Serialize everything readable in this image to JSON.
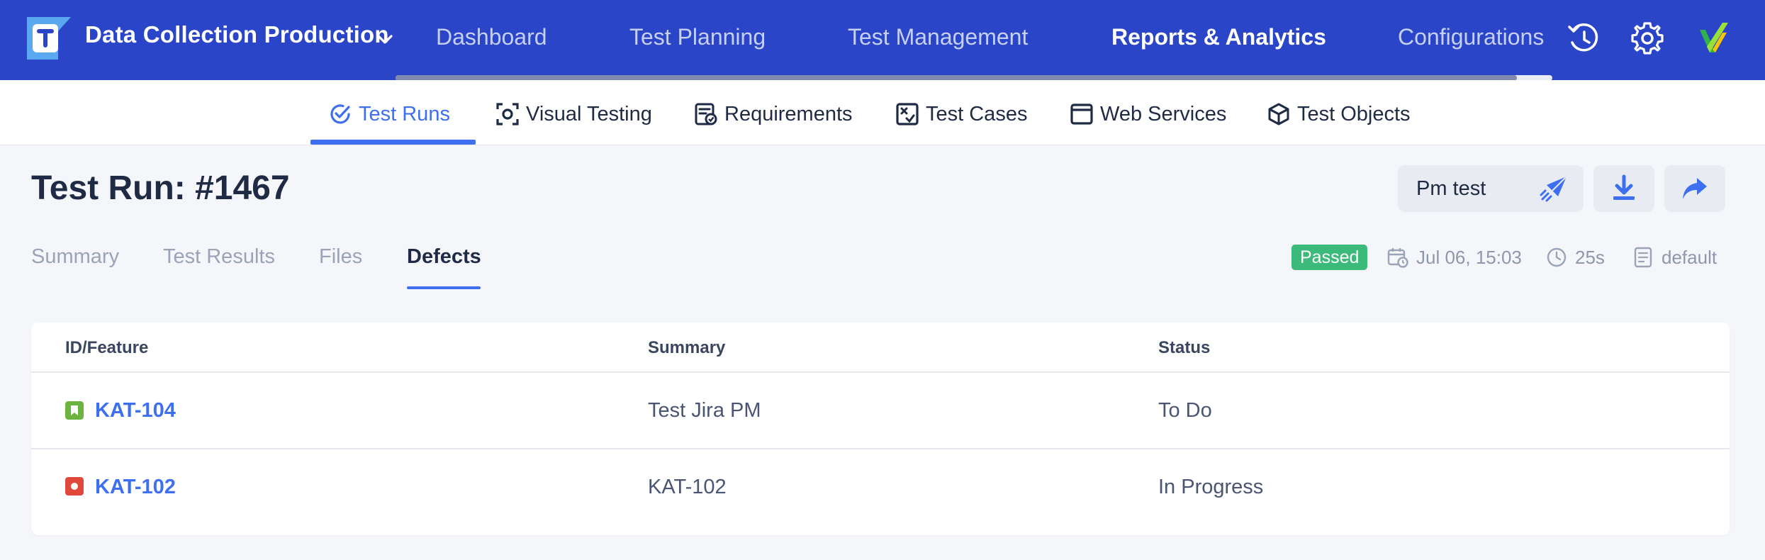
{
  "topbar": {
    "project_name": "Data Collection Production",
    "nav": [
      {
        "label": "Dashboard",
        "active": false
      },
      {
        "label": "Test Planning",
        "active": false
      },
      {
        "label": "Test Management",
        "active": false
      },
      {
        "label": "Reports & Analytics",
        "active": true
      },
      {
        "label": "Configurations",
        "active": false
      }
    ],
    "icons": [
      "history-icon",
      "gear-icon",
      "app-logo-icon"
    ]
  },
  "subnav": {
    "tabs": [
      {
        "label": "Test Runs",
        "icon": "check-circle-icon",
        "active": true
      },
      {
        "label": "Visual Testing",
        "icon": "camera-frame-icon",
        "active": false
      },
      {
        "label": "Requirements",
        "icon": "requirements-icon",
        "active": false
      },
      {
        "label": "Test Cases",
        "icon": "test-cases-icon",
        "active": false
      },
      {
        "label": "Web Services",
        "icon": "browser-window-icon",
        "active": false
      },
      {
        "label": "Test Objects",
        "icon": "cube-icon",
        "active": false
      }
    ]
  },
  "page": {
    "title": "Test Run: #1467",
    "run_button_label": "Pm test",
    "tabs": [
      {
        "label": "Summary",
        "active": false
      },
      {
        "label": "Test Results",
        "active": false
      },
      {
        "label": "Files",
        "active": false
      },
      {
        "label": "Defects",
        "active": true
      }
    ],
    "meta": {
      "status": "Passed",
      "date": "Jul 06, 15:03",
      "duration": "25s",
      "profile": "default"
    }
  },
  "defects_table": {
    "columns": [
      "ID/Feature",
      "Summary",
      "Status"
    ],
    "rows": [
      {
        "id": "KAT-104",
        "summary": "Test Jira PM",
        "status": "To Do",
        "icon_color": "#6cb33f"
      },
      {
        "id": "KAT-102",
        "summary": "KAT-102",
        "status": "In Progress",
        "icon_color": "#e0483b"
      }
    ]
  },
  "colors": {
    "brand": "#2b45c8",
    "accent": "#3d6ff0",
    "passed": "#3cba7a"
  }
}
